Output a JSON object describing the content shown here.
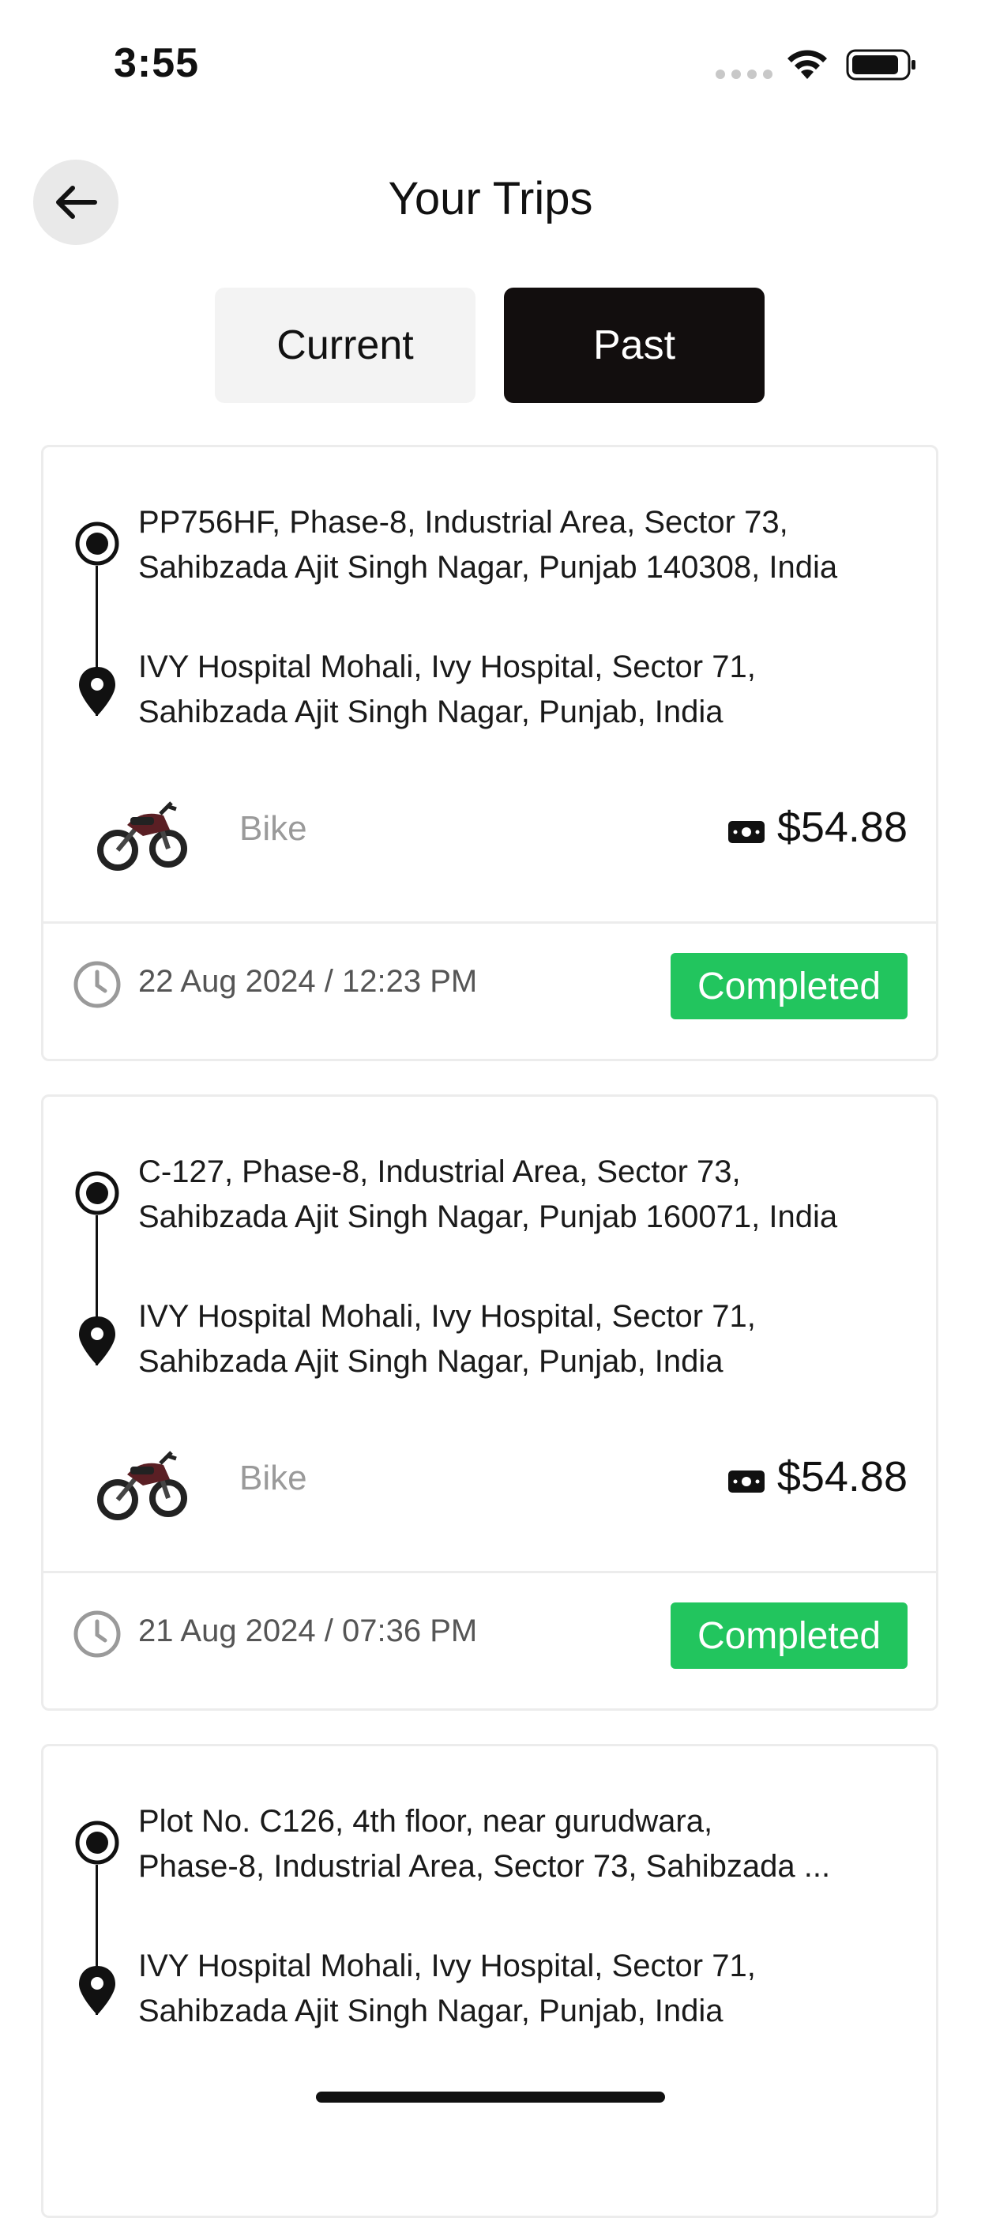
{
  "status_bar": {
    "time": "3:55"
  },
  "header": {
    "title": "Your Trips"
  },
  "tabs": [
    {
      "label": "Current"
    },
    {
      "label": "Past"
    }
  ],
  "trips": [
    {
      "pickup": [
        "PP756HF, Phase-8, Industrial Area, Sector 73,",
        "Sahibzada Ajit Singh Nagar, Punjab 140308, India"
      ],
      "dropoff": [
        "IVY Hospital Mohali, Ivy Hospital, Sector 71,",
        "Sahibzada Ajit Singh Nagar, Punjab, India"
      ],
      "vehicle": "Bike",
      "fare": "$54.88",
      "datetime": "22 Aug 2024 / 12:23 PM",
      "status": "Completed"
    },
    {
      "pickup": [
        "C-127, Phase-8, Industrial Area, Sector 73,",
        "Sahibzada Ajit Singh Nagar, Punjab 160071, India"
      ],
      "dropoff": [
        "IVY Hospital Mohali, Ivy Hospital, Sector 71,",
        "Sahibzada Ajit Singh Nagar, Punjab, India"
      ],
      "vehicle": "Bike",
      "fare": "$54.88",
      "datetime": "21 Aug 2024 / 07:36 PM",
      "status": "Completed"
    },
    {
      "pickup": [
        "Plot No. C126, 4th floor, near gurudwara,",
        "Phase-8, Industrial Area, Sector 73, Sahibzada ..."
      ],
      "dropoff": [
        "IVY Hospital Mohali, Ivy Hospital, Sector 71,",
        "Sahibzada Ajit Singh Nagar, Punjab, India"
      ]
    }
  ],
  "colors": {
    "active_tab": "#120e0e",
    "inactive_tab": "#f3f3f3",
    "status_completed": "#22c55e",
    "back_button": "#e9e9e9"
  },
  "icons": {
    "back": "arrow-left-icon",
    "origin": "origin-pin-icon",
    "destination": "destination-pin-icon",
    "vehicle": "motorbike-image",
    "fare": "cash-icon",
    "time": "clock-icon"
  }
}
